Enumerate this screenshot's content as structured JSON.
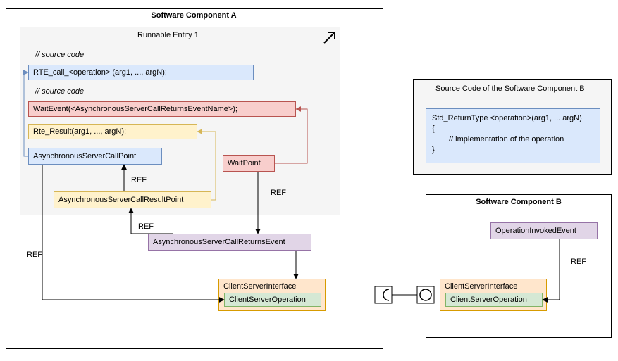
{
  "compA": {
    "title": "Software Component A",
    "runnable": "Runnable Entity 1",
    "comment1": "// source code",
    "rteCall": "RTE_call_<operation> (arg1, ..., argN);",
    "comment2": "// source code",
    "waitEvent": "WaitEvent(<AsynchronousServerCallReturnsEventName>);",
    "rteResult": "Rte_Result(arg1, ..., argN);",
    "asyncCallPoint": "AsynchronousServerCallPoint",
    "asyncResultPoint": "AsynchronousServerCallResultPoint",
    "waitPoint": "WaitPoint",
    "asyncReturnsEvent": "AsynchronousServerCallReturnsEvent",
    "csi": "ClientServerInterface",
    "cso": "ClientServerOperation"
  },
  "srcB": {
    "title": "Source Code of the Software Component B",
    "line1": "Std_ReturnType <operation>(arg1, ... argN)",
    "line2": "{",
    "line3": "// implementation of the operation",
    "line4": "}"
  },
  "compB": {
    "title": "Software Component B",
    "opInvoked": "OperationInvokedEvent",
    "csi": "ClientServerInterface",
    "cso": "ClientServerOperation"
  },
  "ref": "REF"
}
